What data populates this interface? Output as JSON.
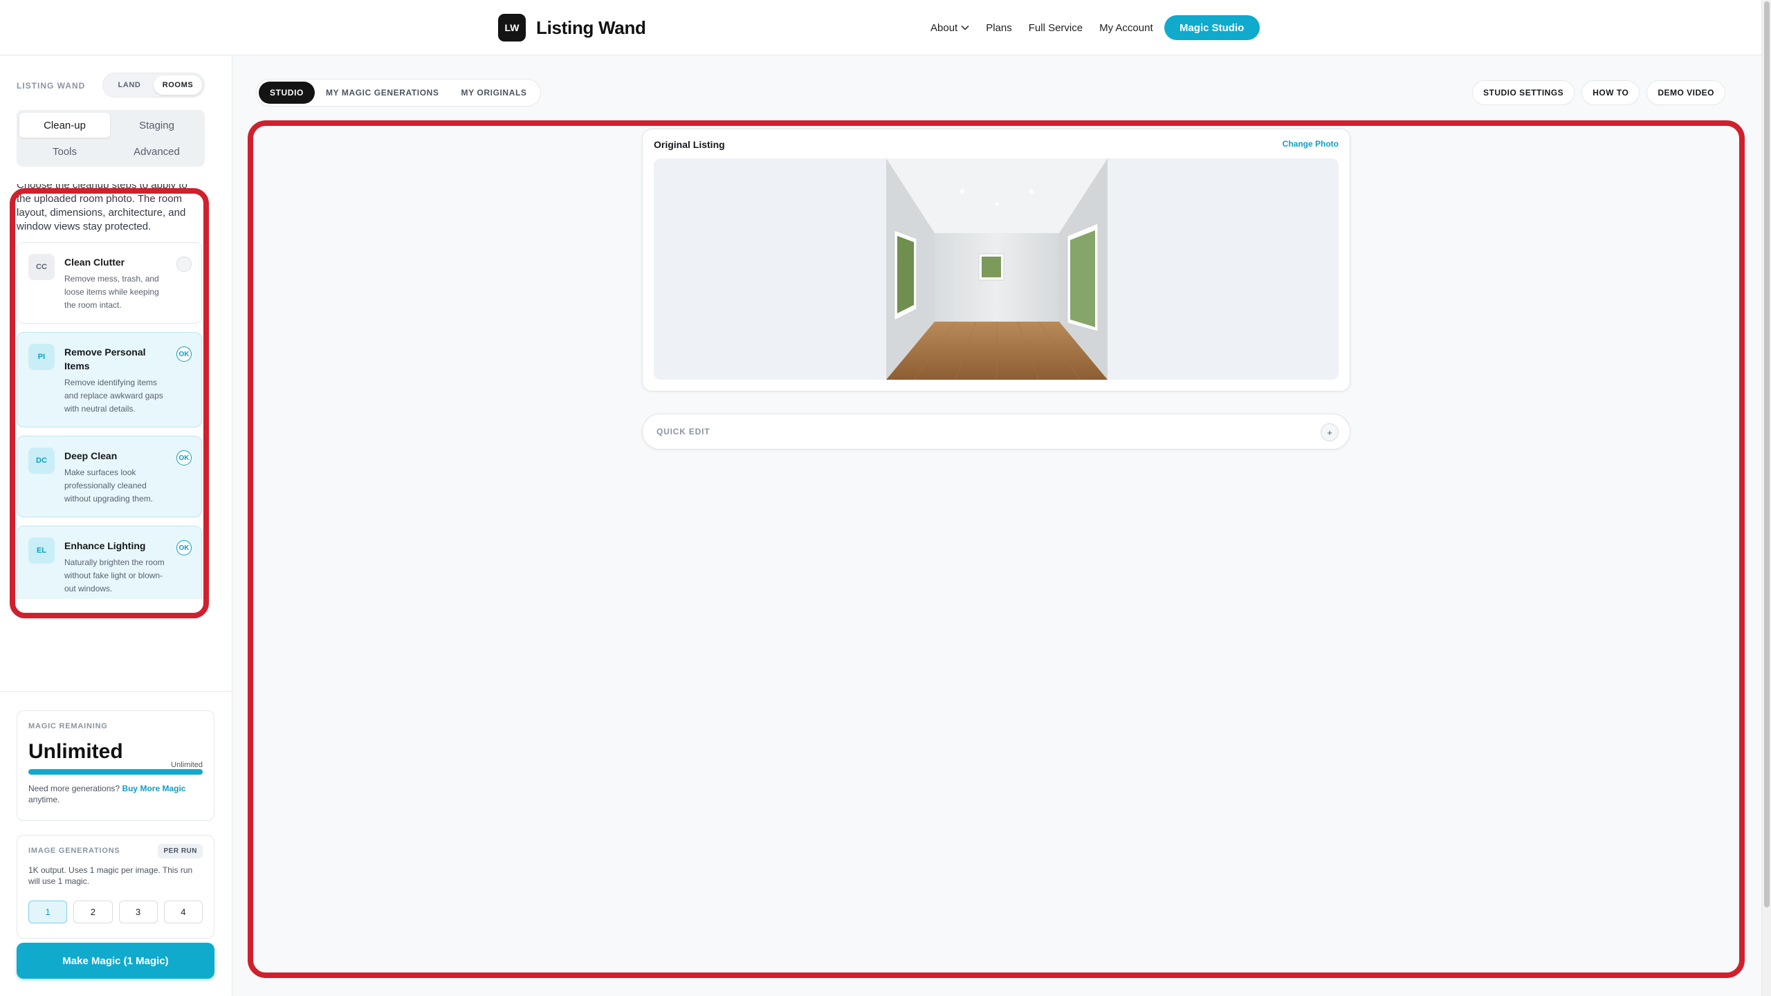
{
  "header": {
    "logo_mark": "LW",
    "brand": "Listing Wand",
    "nav": [
      "About",
      "Plans",
      "Full Service",
      "My Account"
    ],
    "cta": "Magic Studio"
  },
  "sidebar": {
    "brand_label": "LISTING WAND",
    "scope_toggle": {
      "options": [
        "LAND",
        "ROOMS"
      ],
      "selected": "ROOMS"
    },
    "modes": [
      "Clean-up",
      "Staging",
      "Tools",
      "Advanced"
    ],
    "selected_mode": "Clean-up",
    "intro": "Choose the cleanup steps to apply to the uploaded room photo. The room layout, dimensions, architecture, and window views stay protected.",
    "services": [
      {
        "abbr": "CC",
        "title": "Clean Clutter",
        "desc": "Remove mess, trash, and loose items while keeping the room intact.",
        "status": "",
        "selected": false
      },
      {
        "abbr": "PI",
        "title": "Remove Personal Items",
        "desc": "Remove identifying items and replace awkward gaps with neutral details.",
        "status": "OK",
        "selected": true
      },
      {
        "abbr": "DC",
        "title": "Deep Clean",
        "desc": "Make surfaces look professionally cleaned without upgrading them.",
        "status": "OK",
        "selected": true
      },
      {
        "abbr": "EL",
        "title": "Enhance Lighting",
        "desc": "Naturally brighten the room without fake light or blown-out windows.",
        "status": "OK",
        "selected": true
      }
    ],
    "magic": {
      "label": "MAGIC REMAINING",
      "value": "Unlimited",
      "small_value": "Unlimited",
      "fill_fraction": 1.0,
      "note_prefix": "Need more generations?",
      "note_link": "Buy More Magic",
      "note_suffix": "anytime."
    },
    "generations": {
      "label": "IMAGE GENERATIONS",
      "badge": "PER RUN",
      "note": "1K output. Uses 1 magic per image. This run will use 1 magic.",
      "counts": [
        "1",
        "2",
        "3",
        "4"
      ],
      "selected": "1"
    },
    "make_button": "Make Magic (1 Magic)"
  },
  "main": {
    "tabs": [
      "STUDIO",
      "MY MAGIC GENERATIONS",
      "MY ORIGINALS"
    ],
    "active_tab": "STUDIO",
    "actions": [
      "STUDIO SETTINGS",
      "HOW TO",
      "DEMO VIDEO"
    ],
    "original": {
      "title": "Original Listing",
      "change_link": "Change Photo"
    },
    "quick_edit": {
      "label": "QUICK EDIT",
      "icon": "+"
    }
  },
  "colors": {
    "accent": "#10aacd",
    "highlight_frame": "#d0202d",
    "dark": "#141414"
  },
  "icons": {
    "nav_about": "chevron-down-icon",
    "quick_edit": "plus-icon"
  }
}
